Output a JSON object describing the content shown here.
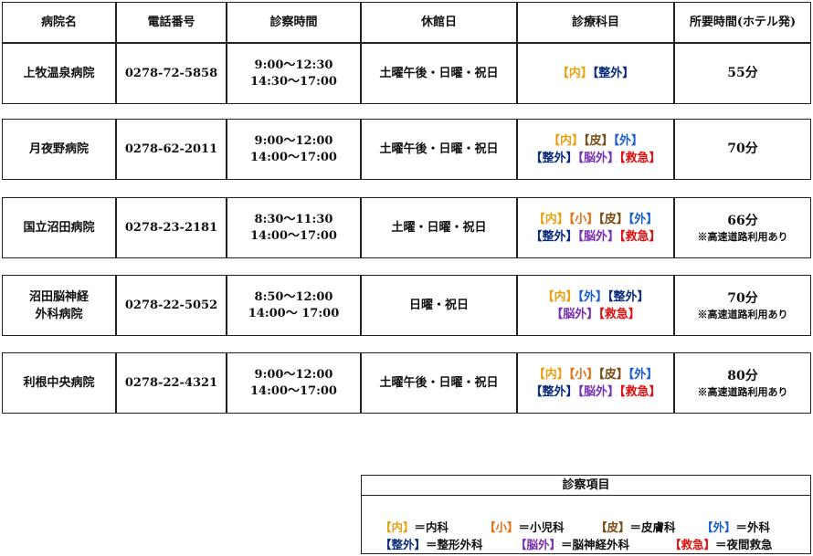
{
  "colors": {
    "naika": "#e8a010",
    "shouni": "#e87010",
    "hifu": "#7a4a10",
    "geka": "#1a5fcf",
    "seikei": "#0a2a7a",
    "noge": "#7a30b0",
    "kyukyu": "#e01010"
  },
  "headers": [
    "病院名",
    "電話番号",
    "診察時間",
    "休館日",
    "診療科目",
    "所要時間(ホテル発)"
  ],
  "rows": [
    {
      "name": [
        "上牧温泉病院"
      ],
      "phone": "0278-72-5858",
      "hours": [
        "9:00～12:30",
        "14:30～17:00"
      ],
      "closed": "土曜午後・日曜・祝日",
      "depts": [
        [
          {
            "t": "【内】",
            "c": "naika"
          },
          {
            "t": "【整外】",
            "c": "seikei"
          }
        ]
      ],
      "duration": "55分",
      "note": ""
    },
    {
      "name": [
        "月夜野病院"
      ],
      "phone": "0278-62-2011",
      "hours": [
        "9:00～12:00",
        "14:00～17:00"
      ],
      "closed": "土曜午後・日曜・祝日",
      "depts": [
        [
          {
            "t": "【内】",
            "c": "naika"
          },
          {
            "t": "【皮】",
            "c": "hifu"
          },
          {
            "t": "【外】",
            "c": "geka"
          }
        ],
        [
          {
            "t": "【整外】",
            "c": "seikei"
          },
          {
            "t": "【脳外】",
            "c": "noge"
          },
          {
            "t": "【救急】",
            "c": "kyukyu"
          }
        ]
      ],
      "duration": "70分",
      "note": ""
    },
    {
      "name": [
        "国立沼田病院"
      ],
      "phone": "0278-23-2181",
      "hours": [
        "8:30～11:30",
        "14:00～17:00"
      ],
      "closed": "土曜・日曜・祝日",
      "depts": [
        [
          {
            "t": "【内】",
            "c": "naika"
          },
          {
            "t": "【小】",
            "c": "shouni"
          },
          {
            "t": "【皮】",
            "c": "hifu"
          },
          {
            "t": "【外】",
            "c": "geka"
          }
        ],
        [
          {
            "t": "【整外】",
            "c": "seikei"
          },
          {
            "t": "【脳外】",
            "c": "noge"
          },
          {
            "t": "【救急】",
            "c": "kyukyu"
          }
        ]
      ],
      "duration": "66分",
      "note": "※高速道路利用あり"
    },
    {
      "name": [
        "沼田脳神経",
        "外科病院"
      ],
      "phone": "0278-22-5052",
      "hours": [
        "8:50～12:00",
        "14:00～ 17:00"
      ],
      "closed": "日曜・祝日",
      "depts": [
        [
          {
            "t": "【内】",
            "c": "naika"
          },
          {
            "t": "【外】",
            "c": "geka"
          },
          {
            "t": "【整外】",
            "c": "seikei"
          }
        ],
        [
          {
            "t": "【脳外】",
            "c": "noge"
          },
          {
            "t": "【救急】",
            "c": "kyukyu"
          }
        ]
      ],
      "duration": "70分",
      "note": "※高速道路利用あり"
    },
    {
      "name": [
        "利根中央病院"
      ],
      "phone": "0278-22-4321",
      "hours": [
        "9:00～12:00",
        "14:00～17:00"
      ],
      "closed": "土曜午後・日曜・祝日",
      "depts": [
        [
          {
            "t": "【内】",
            "c": "naika"
          },
          {
            "t": "【小】",
            "c": "shouni"
          },
          {
            "t": "【皮】",
            "c": "hifu"
          },
          {
            "t": "【外】",
            "c": "geka"
          }
        ],
        [
          {
            "t": "【整外】",
            "c": "seikei"
          },
          {
            "t": "【脳外】",
            "c": "noge"
          },
          {
            "t": "【救急】",
            "c": "kyukyu"
          }
        ]
      ],
      "duration": "80分",
      "note": "※高速道路利用あり"
    }
  ],
  "legend": {
    "title": "診察項目",
    "line1": [
      {
        "t": "【内】",
        "c": "naika",
        "d": "＝内科"
      },
      {
        "t": "【小】",
        "c": "shouni",
        "d": "＝小児科"
      },
      {
        "t": "【皮】",
        "c": "hifu",
        "d": "＝皮膚科"
      },
      {
        "t": "【外】",
        "c": "geka",
        "d": "＝外科"
      }
    ],
    "line2": [
      {
        "t": "【整外】",
        "c": "seikei",
        "d": "＝整形外科"
      },
      {
        "t": "【脳外】",
        "c": "noge",
        "d": "＝脳神経外科"
      },
      {
        "t": "【救急】",
        "c": "kyukyu",
        "d": "＝夜間救急"
      }
    ]
  }
}
